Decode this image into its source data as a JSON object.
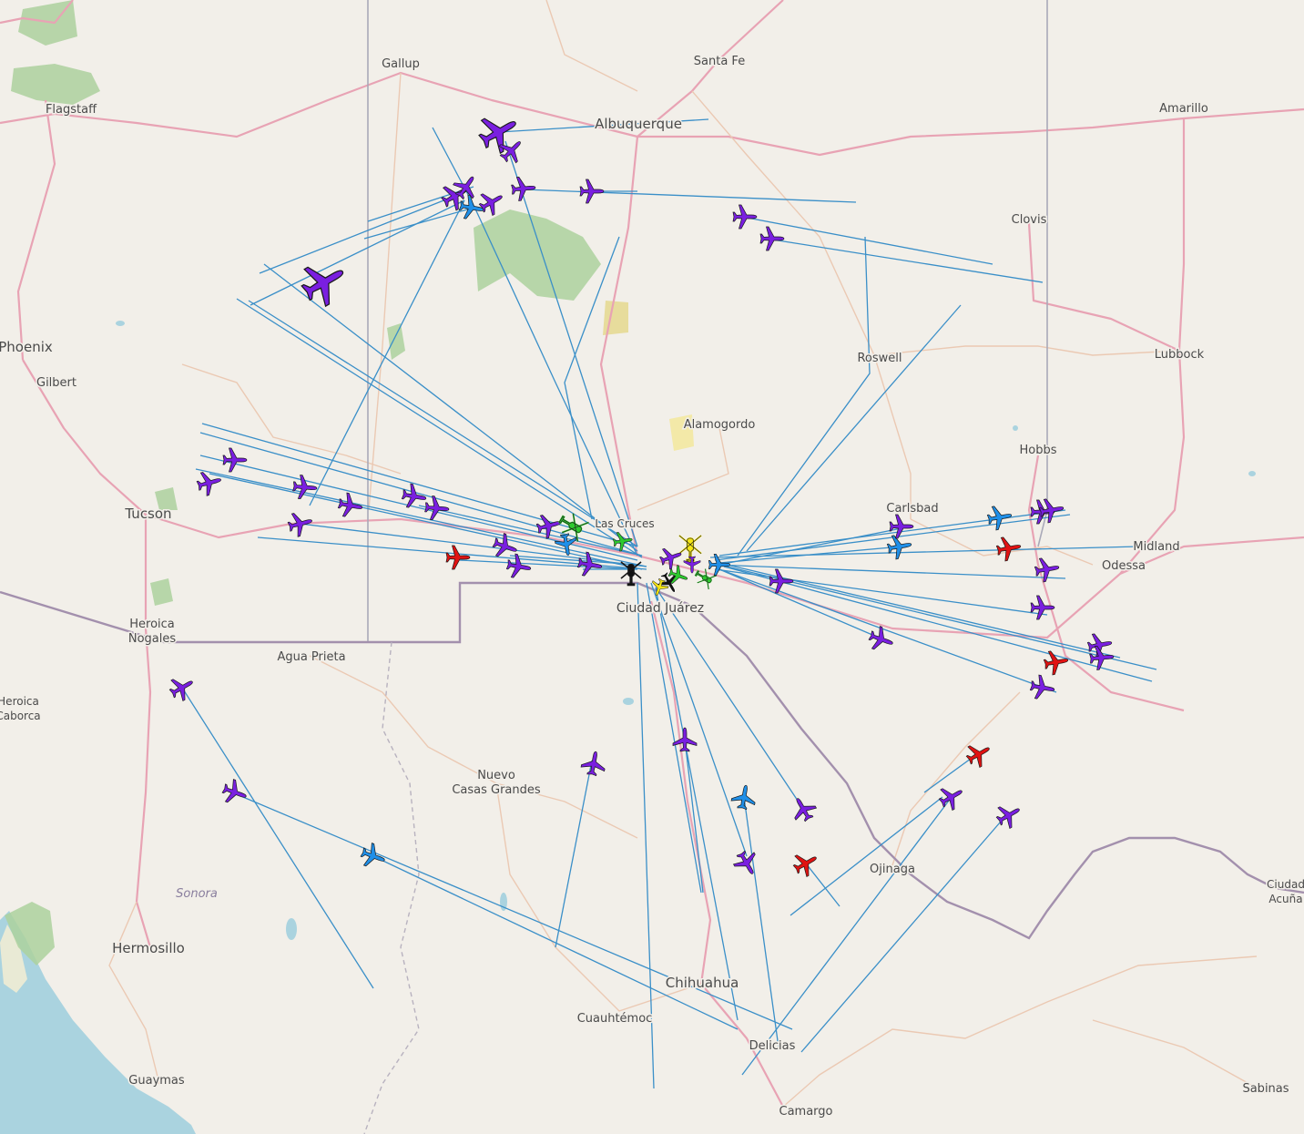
{
  "map": {
    "colors": {
      "land": "#f2efe9",
      "water": "#aad3df",
      "forest": "#add19e",
      "road": "#e8a3b4",
      "minor_road": "#ebc9b3",
      "state_border": "#a9a9b8",
      "intl_border": "#a390ad",
      "track": "#3a8fc8"
    },
    "cities": [
      {
        "name": "Gallup"
      },
      {
        "name": "Santa Fe"
      },
      {
        "name": "Albuquerque"
      },
      {
        "name": "Amarillo"
      },
      {
        "name": "Flagstaff"
      },
      {
        "name": "Clovis"
      },
      {
        "name": "Phoenix"
      },
      {
        "name": "Gilbert"
      },
      {
        "name": "Roswell"
      },
      {
        "name": "Lubbock"
      },
      {
        "name": "Alamogordo"
      },
      {
        "name": "Hobbs"
      },
      {
        "name": "Carlsbad"
      },
      {
        "name": "Tucson"
      },
      {
        "name": "Las Cruces"
      },
      {
        "name": "Midland"
      },
      {
        "name": "Odessa"
      },
      {
        "name": "Ciudad Juárez"
      },
      {
        "name": "Heroica"
      },
      {
        "name": "Nogales"
      },
      {
        "name": "Agua Prieta"
      },
      {
        "name": "Heroica"
      },
      {
        "name": "Caborca"
      },
      {
        "name": "Nuevo"
      },
      {
        "name": "Casas Grandes"
      },
      {
        "name": "Ojinaga"
      },
      {
        "name": "Ciudad"
      },
      {
        "name": "Acuña"
      },
      {
        "name": "Hermosillo"
      },
      {
        "name": "Chihuahua"
      },
      {
        "name": "Cuauhtémoc"
      },
      {
        "name": "Delicias"
      },
      {
        "name": "Guaymas"
      },
      {
        "name": "Sabinas"
      },
      {
        "name": "Camargo"
      }
    ],
    "regions": [
      {
        "name": "Sonora"
      }
    ],
    "aircraft_colors": {
      "purple": "#7a1fe0",
      "blue": "#1f8fe8",
      "red": "#e01212",
      "green": "#2ec92e",
      "yellow": "#f5e614",
      "black": "#111111"
    },
    "aircraft": [
      {
        "color": "purple",
        "type": "jet",
        "icon": "airplane-icon"
      },
      {
        "color": "purple",
        "type": "jet",
        "icon": "airplane-icon"
      },
      {
        "color": "purple",
        "type": "jet",
        "icon": "airplane-icon"
      },
      {
        "color": "purple",
        "type": "jet",
        "icon": "airplane-icon"
      },
      {
        "color": "purple",
        "type": "jet",
        "icon": "airplane-icon"
      },
      {
        "color": "blue",
        "type": "jet",
        "icon": "airplane-icon"
      },
      {
        "color": "purple",
        "type": "jet",
        "icon": "airplane-icon"
      },
      {
        "color": "purple",
        "type": "jet",
        "icon": "airplane-icon"
      },
      {
        "color": "purple",
        "type": "jet",
        "icon": "airplane-icon"
      },
      {
        "color": "purple",
        "type": "jet",
        "icon": "airplane-icon"
      },
      {
        "color": "purple",
        "type": "jet",
        "icon": "airplane-icon"
      },
      {
        "color": "purple",
        "type": "jet",
        "icon": "airplane-icon"
      },
      {
        "color": "purple",
        "type": "jet",
        "icon": "airplane-icon"
      },
      {
        "color": "purple",
        "type": "jet",
        "icon": "airplane-icon"
      },
      {
        "color": "purple",
        "type": "jet",
        "icon": "airplane-icon"
      },
      {
        "color": "purple",
        "type": "jet",
        "icon": "airplane-icon"
      },
      {
        "color": "purple",
        "type": "jet",
        "icon": "airplane-icon"
      },
      {
        "color": "purple",
        "type": "jet",
        "icon": "airplane-icon"
      },
      {
        "color": "purple",
        "type": "jet",
        "icon": "airplane-icon"
      },
      {
        "color": "purple",
        "type": "jet",
        "icon": "airplane-icon"
      },
      {
        "color": "red",
        "type": "jet",
        "icon": "airplane-icon"
      },
      {
        "color": "purple",
        "type": "jet",
        "icon": "airplane-icon"
      },
      {
        "color": "purple",
        "type": "jet",
        "icon": "airplane-icon"
      },
      {
        "color": "purple",
        "type": "jet",
        "icon": "airplane-icon"
      },
      {
        "color": "purple",
        "type": "jet",
        "icon": "airplane-icon"
      },
      {
        "color": "green",
        "type": "heli",
        "icon": "helicopter-icon"
      },
      {
        "color": "blue",
        "type": "jet",
        "icon": "airplane-icon"
      },
      {
        "color": "green",
        "type": "jet",
        "icon": "airplane-icon"
      },
      {
        "color": "yellow",
        "type": "heli",
        "icon": "helicopter-icon"
      },
      {
        "color": "black",
        "type": "heli",
        "icon": "helicopter-icon"
      },
      {
        "color": "black",
        "type": "jet",
        "icon": "airplane-icon"
      },
      {
        "color": "yellow",
        "type": "jet",
        "icon": "airplane-icon"
      },
      {
        "color": "green",
        "type": "jet",
        "icon": "airplane-icon"
      },
      {
        "color": "green",
        "type": "heli",
        "icon": "helicopter-icon"
      },
      {
        "color": "blue",
        "type": "jet",
        "icon": "airplane-icon"
      },
      {
        "color": "purple",
        "type": "jet",
        "icon": "airplane-icon"
      },
      {
        "color": "purple",
        "type": "jet",
        "icon": "airplane-icon"
      },
      {
        "color": "blue",
        "type": "jet",
        "icon": "airplane-icon"
      },
      {
        "color": "blue",
        "type": "jet",
        "icon": "airplane-icon"
      },
      {
        "color": "purple",
        "type": "jet",
        "icon": "airplane-icon"
      },
      {
        "color": "red",
        "type": "jet",
        "icon": "airplane-icon"
      },
      {
        "color": "purple",
        "type": "jet",
        "icon": "airplane-icon"
      },
      {
        "color": "purple",
        "type": "jet",
        "icon": "airplane-icon"
      },
      {
        "color": "purple",
        "type": "jet",
        "icon": "airplane-icon"
      },
      {
        "color": "purple",
        "type": "jet",
        "icon": "airplane-icon"
      },
      {
        "color": "purple",
        "type": "jet",
        "icon": "airplane-icon"
      },
      {
        "color": "red",
        "type": "jet",
        "icon": "airplane-icon"
      },
      {
        "color": "purple",
        "type": "jet",
        "icon": "airplane-icon"
      },
      {
        "color": "purple",
        "type": "jet",
        "icon": "airplane-icon"
      },
      {
        "color": "purple",
        "type": "jet",
        "icon": "airplane-icon"
      },
      {
        "color": "purple",
        "type": "jet",
        "icon": "airplane-icon"
      },
      {
        "color": "blue",
        "type": "jet",
        "icon": "airplane-icon"
      },
      {
        "color": "purple",
        "type": "jet",
        "icon": "airplane-icon"
      },
      {
        "color": "purple",
        "type": "jet",
        "icon": "airplane-icon"
      },
      {
        "color": "blue",
        "type": "jet",
        "icon": "airplane-icon"
      },
      {
        "color": "red",
        "type": "jet",
        "icon": "airplane-icon"
      },
      {
        "color": "red",
        "type": "jet",
        "icon": "airplane-icon"
      },
      {
        "color": "purple",
        "type": "jet",
        "icon": "airplane-icon"
      },
      {
        "color": "purple",
        "type": "jet",
        "icon": "airplane-icon"
      },
      {
        "color": "purple",
        "type": "jet",
        "icon": "airplane-icon"
      },
      {
        "color": "purple",
        "type": "jet",
        "icon": "airplane-icon"
      }
    ]
  }
}
